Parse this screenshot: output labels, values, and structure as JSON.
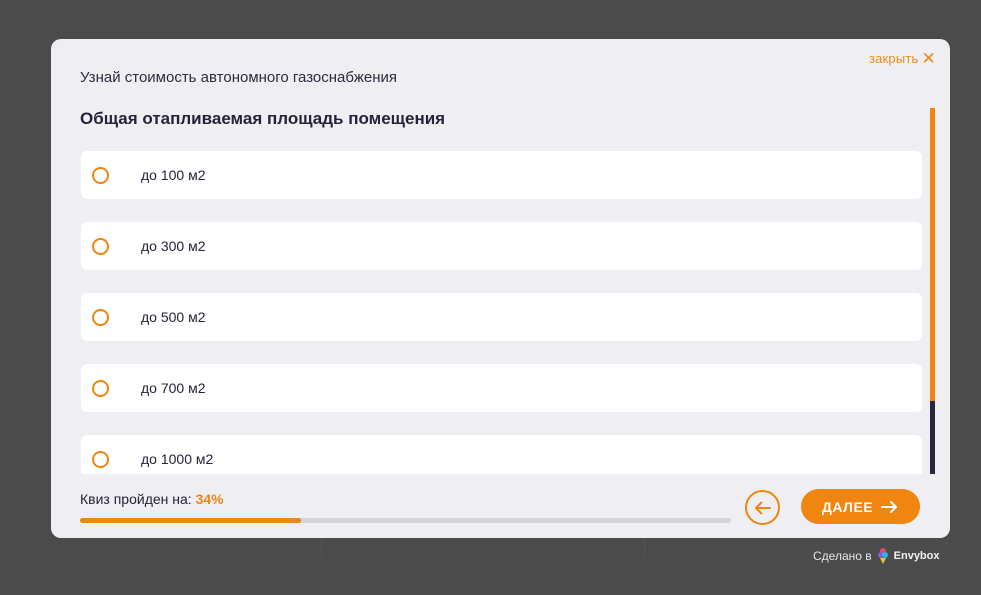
{
  "modal": {
    "close_label": "закрыть",
    "subtitle": "Узнай стоимость автономного газоснабжения",
    "question": "Общая отапливаемая площадь помещения",
    "options": [
      {
        "label": "до 100 м2"
      },
      {
        "label": "до 300 м2"
      },
      {
        "label": "до 500 м2"
      },
      {
        "label": "до 700 м2"
      },
      {
        "label": "до 1000 м2"
      }
    ],
    "progress": {
      "label": "Квиз пройден на:",
      "percent_text": "34%",
      "value": 0.34
    },
    "next_label": "ДАЛЕЕ"
  },
  "footer": {
    "made_by": "Сделано в",
    "brand": "Envybox"
  },
  "colors": {
    "accent": "#f0850f",
    "dark": "#24233a",
    "modal_bg": "#efeff3"
  }
}
